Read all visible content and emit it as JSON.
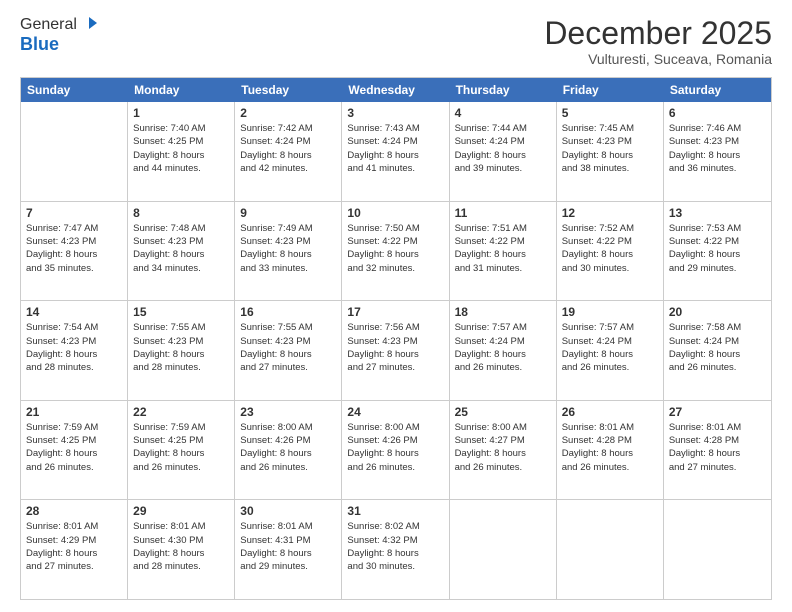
{
  "logo": {
    "general": "General",
    "blue": "Blue"
  },
  "title": "December 2025",
  "location": "Vulturesti, Suceava, Romania",
  "header_days": [
    "Sunday",
    "Monday",
    "Tuesday",
    "Wednesday",
    "Thursday",
    "Friday",
    "Saturday"
  ],
  "weeks": [
    [
      {
        "day": "",
        "info": ""
      },
      {
        "day": "1",
        "info": "Sunrise: 7:40 AM\nSunset: 4:25 PM\nDaylight: 8 hours\nand 44 minutes."
      },
      {
        "day": "2",
        "info": "Sunrise: 7:42 AM\nSunset: 4:24 PM\nDaylight: 8 hours\nand 42 minutes."
      },
      {
        "day": "3",
        "info": "Sunrise: 7:43 AM\nSunset: 4:24 PM\nDaylight: 8 hours\nand 41 minutes."
      },
      {
        "day": "4",
        "info": "Sunrise: 7:44 AM\nSunset: 4:24 PM\nDaylight: 8 hours\nand 39 minutes."
      },
      {
        "day": "5",
        "info": "Sunrise: 7:45 AM\nSunset: 4:23 PM\nDaylight: 8 hours\nand 38 minutes."
      },
      {
        "day": "6",
        "info": "Sunrise: 7:46 AM\nSunset: 4:23 PM\nDaylight: 8 hours\nand 36 minutes."
      }
    ],
    [
      {
        "day": "7",
        "info": "Sunrise: 7:47 AM\nSunset: 4:23 PM\nDaylight: 8 hours\nand 35 minutes."
      },
      {
        "day": "8",
        "info": "Sunrise: 7:48 AM\nSunset: 4:23 PM\nDaylight: 8 hours\nand 34 minutes."
      },
      {
        "day": "9",
        "info": "Sunrise: 7:49 AM\nSunset: 4:23 PM\nDaylight: 8 hours\nand 33 minutes."
      },
      {
        "day": "10",
        "info": "Sunrise: 7:50 AM\nSunset: 4:22 PM\nDaylight: 8 hours\nand 32 minutes."
      },
      {
        "day": "11",
        "info": "Sunrise: 7:51 AM\nSunset: 4:22 PM\nDaylight: 8 hours\nand 31 minutes."
      },
      {
        "day": "12",
        "info": "Sunrise: 7:52 AM\nSunset: 4:22 PM\nDaylight: 8 hours\nand 30 minutes."
      },
      {
        "day": "13",
        "info": "Sunrise: 7:53 AM\nSunset: 4:22 PM\nDaylight: 8 hours\nand 29 minutes."
      }
    ],
    [
      {
        "day": "14",
        "info": "Sunrise: 7:54 AM\nSunset: 4:23 PM\nDaylight: 8 hours\nand 28 minutes."
      },
      {
        "day": "15",
        "info": "Sunrise: 7:55 AM\nSunset: 4:23 PM\nDaylight: 8 hours\nand 28 minutes."
      },
      {
        "day": "16",
        "info": "Sunrise: 7:55 AM\nSunset: 4:23 PM\nDaylight: 8 hours\nand 27 minutes."
      },
      {
        "day": "17",
        "info": "Sunrise: 7:56 AM\nSunset: 4:23 PM\nDaylight: 8 hours\nand 27 minutes."
      },
      {
        "day": "18",
        "info": "Sunrise: 7:57 AM\nSunset: 4:24 PM\nDaylight: 8 hours\nand 26 minutes."
      },
      {
        "day": "19",
        "info": "Sunrise: 7:57 AM\nSunset: 4:24 PM\nDaylight: 8 hours\nand 26 minutes."
      },
      {
        "day": "20",
        "info": "Sunrise: 7:58 AM\nSunset: 4:24 PM\nDaylight: 8 hours\nand 26 minutes."
      }
    ],
    [
      {
        "day": "21",
        "info": "Sunrise: 7:59 AM\nSunset: 4:25 PM\nDaylight: 8 hours\nand 26 minutes."
      },
      {
        "day": "22",
        "info": "Sunrise: 7:59 AM\nSunset: 4:25 PM\nDaylight: 8 hours\nand 26 minutes."
      },
      {
        "day": "23",
        "info": "Sunrise: 8:00 AM\nSunset: 4:26 PM\nDaylight: 8 hours\nand 26 minutes."
      },
      {
        "day": "24",
        "info": "Sunrise: 8:00 AM\nSunset: 4:26 PM\nDaylight: 8 hours\nand 26 minutes."
      },
      {
        "day": "25",
        "info": "Sunrise: 8:00 AM\nSunset: 4:27 PM\nDaylight: 8 hours\nand 26 minutes."
      },
      {
        "day": "26",
        "info": "Sunrise: 8:01 AM\nSunset: 4:28 PM\nDaylight: 8 hours\nand 26 minutes."
      },
      {
        "day": "27",
        "info": "Sunrise: 8:01 AM\nSunset: 4:28 PM\nDaylight: 8 hours\nand 27 minutes."
      }
    ],
    [
      {
        "day": "28",
        "info": "Sunrise: 8:01 AM\nSunset: 4:29 PM\nDaylight: 8 hours\nand 27 minutes."
      },
      {
        "day": "29",
        "info": "Sunrise: 8:01 AM\nSunset: 4:30 PM\nDaylight: 8 hours\nand 28 minutes."
      },
      {
        "day": "30",
        "info": "Sunrise: 8:01 AM\nSunset: 4:31 PM\nDaylight: 8 hours\nand 29 minutes."
      },
      {
        "day": "31",
        "info": "Sunrise: 8:02 AM\nSunset: 4:32 PM\nDaylight: 8 hours\nand 30 minutes."
      },
      {
        "day": "",
        "info": ""
      },
      {
        "day": "",
        "info": ""
      },
      {
        "day": "",
        "info": ""
      }
    ]
  ]
}
